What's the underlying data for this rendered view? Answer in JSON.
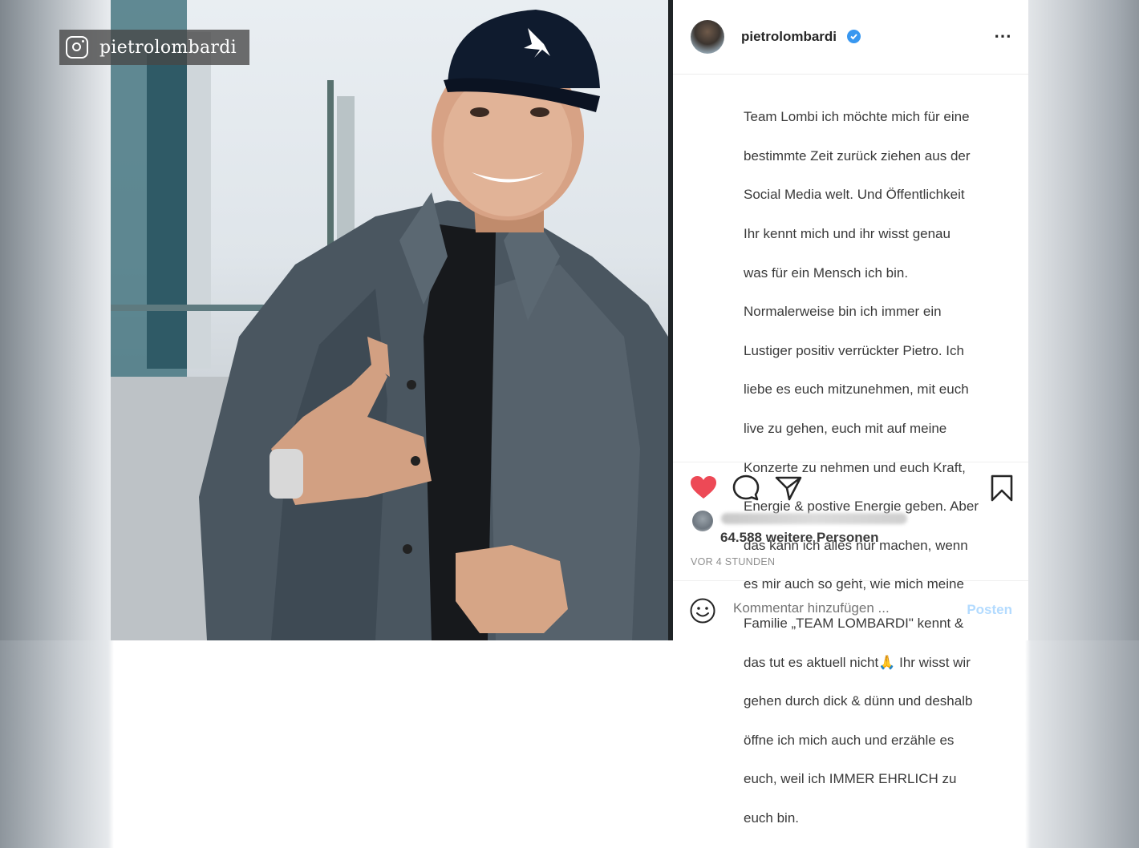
{
  "watermark": {
    "handle": "pietrolombardi"
  },
  "post": {
    "username": "pietrolombardi",
    "more_icon": "⋯",
    "caption_lines": [
      "Team Lombi ich möchte mich für eine",
      "bestimmte Zeit zurück ziehen aus der",
      "Social Media welt. Und Öffentlichkeit",
      "Ihr kennt mich und ihr wisst genau",
      "was für ein Mensch ich bin.",
      "Normalerweise bin ich immer ein",
      " Lustiger positiv verrückter Pietro. Ich",
      " liebe es euch mitzunehmen, mit euch",
      " live zu gehen, euch mit auf meine",
      " Konzerte zu nehmen und euch Kraft,",
      " Energie & postive Energie geben. Aber",
      " das kann ich alles nur machen, wenn",
      " es mir auch so geht, wie mich meine",
      " Familie „TEAM LOMBARDI\" kennt &",
      " das tut es aktuell nicht🙏 Ihr wisst wir",
      "gehen durch dick & dünn und deshalb",
      "öffne ich mich auch und erzähle es",
      "euch, weil ich IMMER EHRLICH zu",
      "euch bin."
    ],
    "likes_text": "64.588 weitere Personen",
    "timestamp": "VOR 4 STUNDEN",
    "comment_placeholder": "Kommentar hinzufügen ...",
    "post_button": "Posten"
  },
  "colors": {
    "like_red": "#ed4956",
    "verified_blue": "#3897f0",
    "post_button_disabled": "#b3dbff"
  },
  "icons": [
    "instagram-icon",
    "verified-icon",
    "more-icon",
    "heart-icon",
    "comment-icon",
    "share-icon",
    "bookmark-icon",
    "emoji-icon"
  ]
}
